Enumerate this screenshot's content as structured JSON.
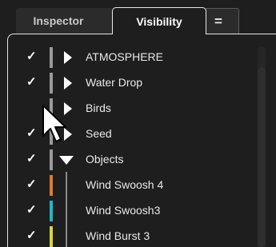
{
  "tabs": {
    "inspector": "Inspector",
    "visibility": "Visibility",
    "menu": "="
  },
  "rows": [
    {
      "label": "ATMOSPHERE",
      "checked": true,
      "color": "#9a9a9a",
      "expander": "collapsed"
    },
    {
      "label": "Water Drop",
      "checked": true,
      "color": "#9a9a9a",
      "expander": "collapsed"
    },
    {
      "label": "Birds",
      "checked": false,
      "color": "#9a9a9a",
      "expander": "collapsed"
    },
    {
      "label": "Seed",
      "checked": true,
      "color": "#9a9a9a",
      "expander": "collapsed"
    },
    {
      "label": "Objects",
      "checked": true,
      "color": "#9a9a9a",
      "expander": "expanded"
    },
    {
      "label": "Wind Swoosh 4",
      "checked": true,
      "color": "#e07a2a",
      "expander": "none"
    },
    {
      "label": "Wind Swoosh3",
      "checked": true,
      "color": "#1fb6c9",
      "expander": "none"
    },
    {
      "label": "Wind Burst 3",
      "checked": true,
      "color": "#d6d63a",
      "expander": "none"
    }
  ],
  "check_glyph": "✓",
  "icons": {
    "expand": "chevron-right-icon",
    "collapse": "chevron-down-icon",
    "cursor": "mouse-pointer-icon"
  }
}
